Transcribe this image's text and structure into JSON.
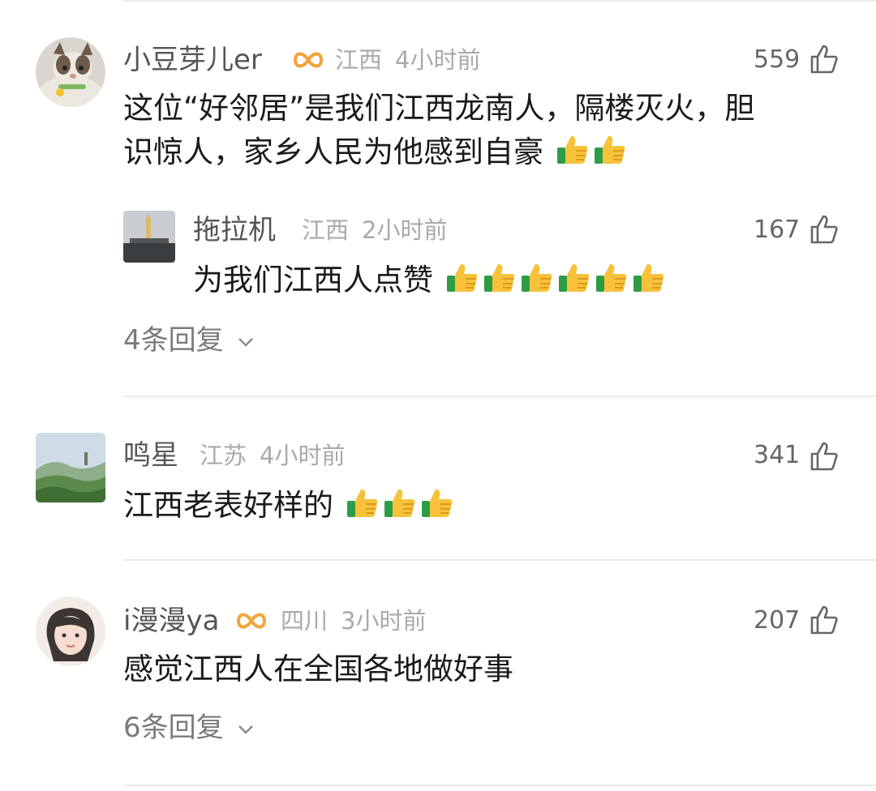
{
  "comments": [
    {
      "name": "小豆芽儿er",
      "region": "江西",
      "time": "4小时前",
      "likes": "559",
      "text_line1": "这位“好邻居”是我们江西龙南人，隔楼灭火，胆",
      "text_line2": "识惊人，家乡人民为他感到自豪",
      "emoji_count": 2,
      "reply": {
        "name": "拖拉机",
        "region": "江西",
        "time": "2小时前",
        "likes": "167",
        "text": "为我们江西人点赞",
        "emoji_count": 6
      },
      "more_replies": "4条回复"
    },
    {
      "name": "鸣星",
      "region": "江苏",
      "time": "4小时前",
      "likes": "341",
      "text": "江西老表好样的",
      "emoji_count": 3
    },
    {
      "name": "i漫漫ya",
      "region": "四川",
      "time": "3小时前",
      "likes": "207",
      "text": "感觉江西人在全国各地做好事",
      "more_replies": "6条回复"
    }
  ],
  "icons": {
    "like": "thumbs-up-outline-icon",
    "badge": "vip-badge-icon",
    "emoji": "thumbs-up-emoji-icon",
    "chevron": "chevron-down-icon"
  },
  "colors": {
    "badge": "#f2a43a",
    "emoji_yellow": "#f7c23a",
    "emoji_green": "#2e9c46"
  }
}
